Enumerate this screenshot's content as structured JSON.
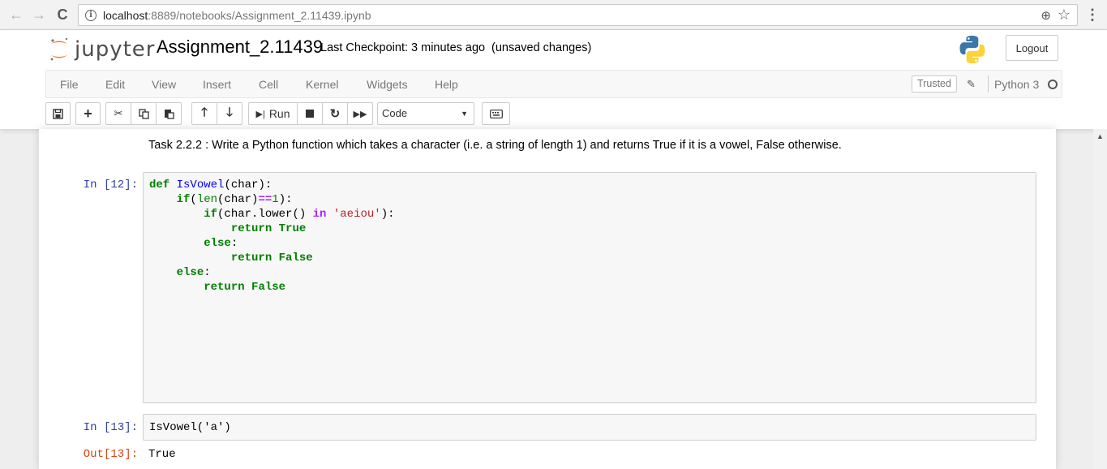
{
  "browser": {
    "url_host": "localhost",
    "url_rest": ":8889/notebooks/Assignment_2.11439.ipynb",
    "back": "←",
    "forward": "→",
    "reload": "C",
    "zoom": "⊕",
    "star": "☆",
    "menu": "⋮"
  },
  "header": {
    "logo_text": "jupyter",
    "title": "Assignment_2.11439",
    "checkpoint": "Last Checkpoint: 3 minutes ago",
    "unsaved": "(unsaved changes)",
    "logout_label": "Logout"
  },
  "menubar": {
    "items": [
      "File",
      "Edit",
      "View",
      "Insert",
      "Cell",
      "Kernel",
      "Widgets",
      "Help"
    ],
    "trusted_label": "Trusted",
    "kernel_name": "Python 3"
  },
  "toolbar": {
    "run_label": "Run",
    "cell_type": "Code"
  },
  "cells": {
    "markdown_text": "Task 2.2.2 : Write a Python function which takes a character (i.e. a string of length 1) and returns True if it is a vowel, False otherwise.",
    "cell1_prompt": "In [12]:",
    "cell2_prompt": "In [13]:",
    "cell2_code": "IsVowel('a')",
    "out_prompt": "Out[13]:",
    "out_value": "True"
  },
  "colors": {
    "keyword": "#008000",
    "function_name": "#0000ff",
    "string": "#ba2121",
    "operator": "#aa22ff",
    "in_prompt": "#303f9f",
    "out_prompt": "#d84315",
    "jupyter_orange": "#f37726"
  }
}
